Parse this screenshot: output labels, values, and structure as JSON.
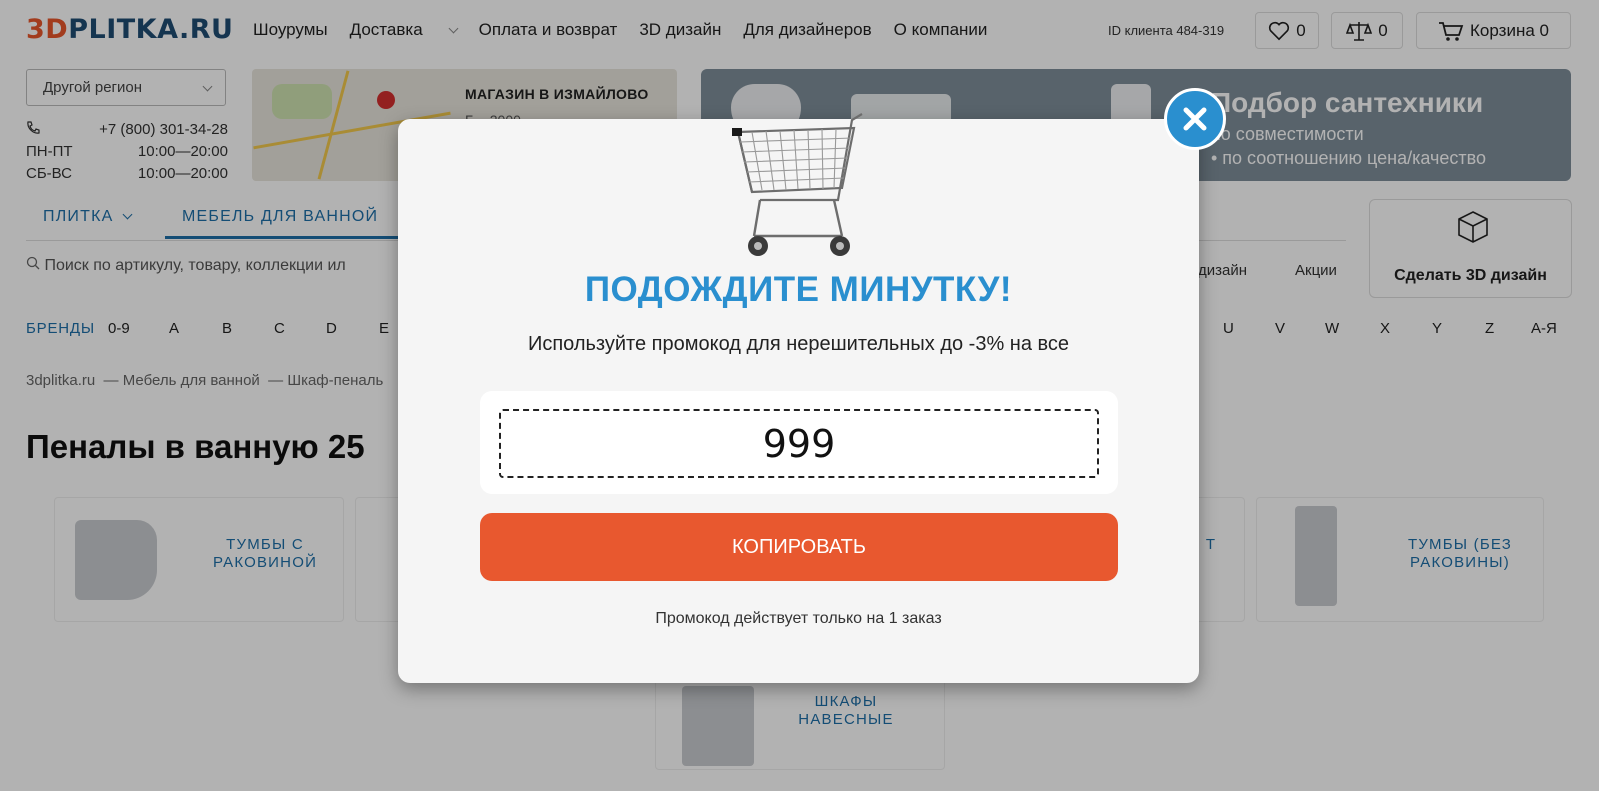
{
  "header": {
    "logo_3d": "3D",
    "logo_rest": "PLITKA.RU",
    "nav": [
      "Шоурумы",
      "Доставка",
      "Оплата и возврат",
      "3D дизайн",
      "Для дизайнеров",
      "О компании"
    ],
    "client_id": "ID клиента 484-319",
    "favorites_count": "0",
    "compare_count": "0",
    "cart_label": "Корзина 0"
  },
  "contacts": {
    "region": "Другой регион",
    "phone": "+7 (800) 301-34-28",
    "weekday_label": "ПН-ПТ",
    "weekday_hours": "10:00—20:00",
    "weekend_label": "СБ-ВС",
    "weekend_hours": "10:00—20:00"
  },
  "store": {
    "name": "МАГАЗИН В ИЗМАЙЛОВО",
    "sub": "Б... 2000"
  },
  "banner": {
    "title": "Подбор сантехники",
    "line1": "по совместимости",
    "line2": "• по соотношению цена/качество"
  },
  "menu": {
    "item1": "ПЛИТКА",
    "item2": "МЕБЕЛЬ ДЛЯ ВАННОЙ",
    "search_placeholder": "Поиск по артикулу, товару, коллекции ил",
    "link_design": "дизайн",
    "link_promo": "Акции",
    "make3d": "Сделать 3D дизайн"
  },
  "brands": {
    "label": "БРЕНДЫ",
    "left": [
      "0-9",
      "A",
      "B",
      "C",
      "D",
      "E"
    ],
    "right": [
      "U",
      "V",
      "W",
      "X",
      "Y",
      "Z",
      "А-Я"
    ]
  },
  "breadcrumb": [
    "3dplitka.ru",
    "Мебель для ванной",
    "Шкаф-пеналь"
  ],
  "page_title": "Пеналы в ванную 25",
  "categories": {
    "c1": "ТУМБЫ С РАКОВИНОЙ",
    "c3_partial": "Т",
    "c4": "ТУМБЫ (БЕЗ РАКОВИНЫ)",
    "c5": "ШКАФЫ НАВЕСНЫЕ"
  },
  "modal": {
    "title": "ПОДОЖДИТЕ МИНУТКУ!",
    "subtitle": "Используйте промокод для нерешительных до -3% на все",
    "promo_code": "999",
    "copy_button": "КОПИРОВАТЬ",
    "note": "Промокод действует только на 1 заказ"
  },
  "colors": {
    "accent_blue": "#2a8fcf",
    "accent_orange": "#e8582f",
    "logo_orange": "#e8572b",
    "logo_navy": "#1f4c73"
  }
}
